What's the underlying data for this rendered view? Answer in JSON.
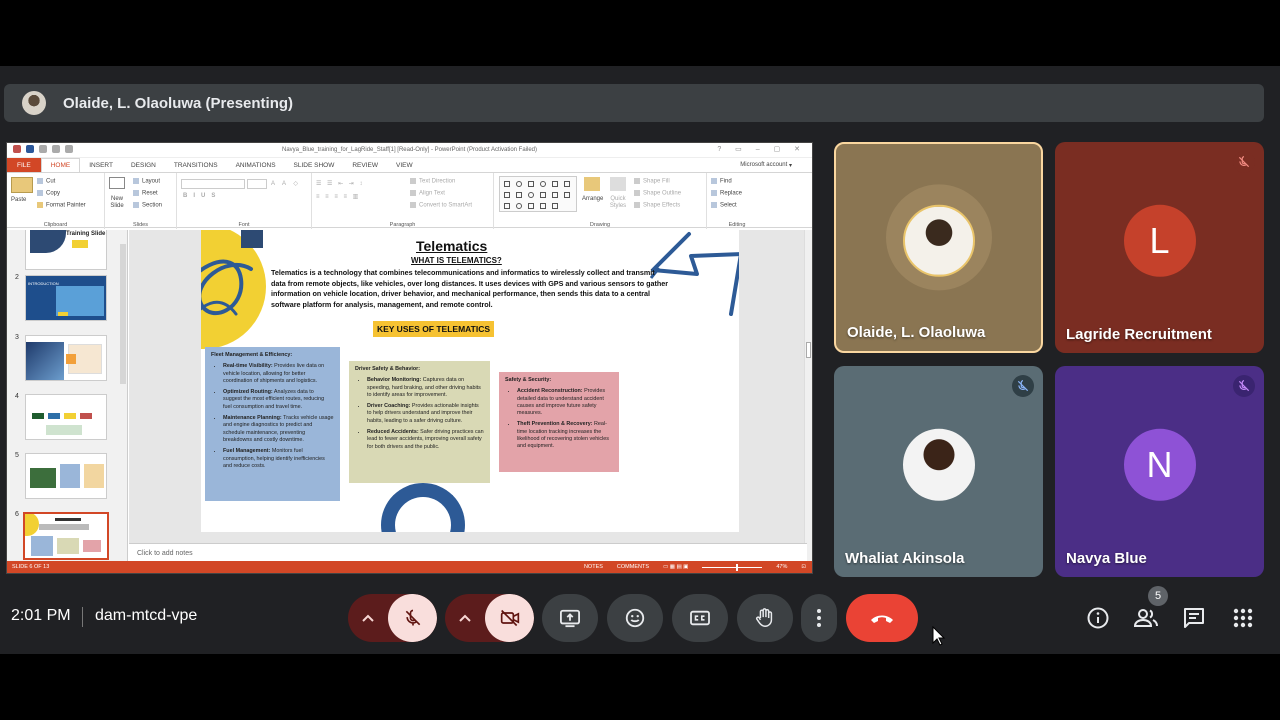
{
  "presenter": {
    "name": "Olaide, L. Olaoluwa (Presenting)"
  },
  "screen": {
    "window_title": "Navya_Blue_training_for_LagRide_Staff[1] [Read-Only] - PowerPoint (Product Activation Failed)",
    "account": "Microsoft account",
    "tabs": [
      "FILE",
      "HOME",
      "INSERT",
      "DESIGN",
      "TRANSITIONS",
      "ANIMATIONS",
      "SLIDE SHOW",
      "REVIEW",
      "VIEW"
    ],
    "active_tab": "HOME",
    "ribbon": {
      "clipboard": {
        "paste": "Paste",
        "cut": "Cut",
        "copy": "Copy",
        "format_painter": "Format Painter",
        "label": "Clipboard"
      },
      "slides": {
        "new_slide": "New Slide",
        "layout": "Layout",
        "reset": "Reset",
        "section": "Section",
        "label": "Slides"
      },
      "font": {
        "bold": "B",
        "italic": "I",
        "underline": "U",
        "strike": "S",
        "label": "Font"
      },
      "paragraph": {
        "text_direction": "Text Direction",
        "align_text": "Align Text",
        "convert": "Convert to SmartArt",
        "label": "Paragraph"
      },
      "drawing": {
        "arrange": "Arrange",
        "quick_styles": "Quick Styles",
        "shape_fill": "Shape Fill",
        "shape_outline": "Shape Outline",
        "shape_effects": "Shape Effects",
        "label": "Drawing"
      },
      "editing": {
        "find": "Find",
        "replace": "Replace",
        "select": "Select",
        "label": "Editing"
      }
    },
    "slide_numbers": [
      "2",
      "3",
      "4",
      "5",
      "6"
    ],
    "thumb1_caption": "Training Slide",
    "thumb2_caption": "INTRODUCTION",
    "slide": {
      "title": "Telematics",
      "subtitle": "WHAT IS TELEMATICS?",
      "body": "Telematics is a technology that combines telecommunications and informatics to wirelessly collect and transmit data from remote objects, like vehicles, over long distances. It uses devices with GPS and various sensors to gather information on vehicle location, driver behavior, and mechanical performance, then sends this data to a central software platform for analysis, management, and remote control.",
      "key_uses": "KEY USES OF TELEMATICS",
      "card1": {
        "heading": "Fleet Management & Efficiency:",
        "items": [
          {
            "b": "Real-time Visibility:",
            "t": " Provides live data on vehicle location, allowing for better coordination of shipments and logistics."
          },
          {
            "b": "Optimized Routing:",
            "t": " Analyzes data to suggest the most efficient routes, reducing fuel consumption and travel time."
          },
          {
            "b": "Maintenance Planning:",
            "t": " Tracks vehicle usage and engine diagnostics to predict and schedule maintenance, preventing breakdowns and costly downtime."
          },
          {
            "b": "Fuel Management:",
            "t": " Monitors fuel consumption, helping identify inefficiencies and reduce costs."
          }
        ]
      },
      "card2": {
        "heading": "Driver Safety & Behavior:",
        "items": [
          {
            "b": "Behavior Monitoring:",
            "t": " Captures data on speeding, hard braking, and other driving habits to identify areas for improvement."
          },
          {
            "b": "Driver Coaching:",
            "t": " Provides actionable insights to help drivers understand and improve their habits, leading to a safer driving culture."
          },
          {
            "b": "Reduced Accidents:",
            "t": " Safer driving practices can lead to fewer accidents, improving overall safety for both drivers and the public."
          }
        ]
      },
      "card3": {
        "heading": "Safety & Security:",
        "items": [
          {
            "b": "Accident Reconstruction:",
            "t": " Provides detailed data to understand accident causes and improve future safety measures."
          },
          {
            "b": "Theft Prevention & Recovery:",
            "t": " Real-time location tracking increases the likelihood of recovering stolen vehicles and equipment."
          }
        ]
      }
    },
    "notes_placeholder": "Click to add notes",
    "status": {
      "slide_info": "SLIDE 6 OF 13",
      "notes": "NOTES",
      "comments": "COMMENTS",
      "zoom": "47%"
    }
  },
  "participants": [
    {
      "name": "Olaide, L. Olaoluwa",
      "initial": "",
      "muted": false
    },
    {
      "name": "Lagride Recruitment",
      "initial": "L",
      "muted": true
    },
    {
      "name": "Whaliat Akinsola",
      "initial": "",
      "muted": true
    },
    {
      "name": "Navya Blue",
      "initial": "N",
      "muted": true
    }
  ],
  "controls": {
    "time": "2:01 PM",
    "meeting_code": "dam-mtcd-vpe",
    "people_count": "5"
  },
  "colors": {
    "accent_red": "#ea4335",
    "ppt_orange": "#d24726",
    "active_border": "#fad7a0",
    "end_call": "#ea4335"
  }
}
